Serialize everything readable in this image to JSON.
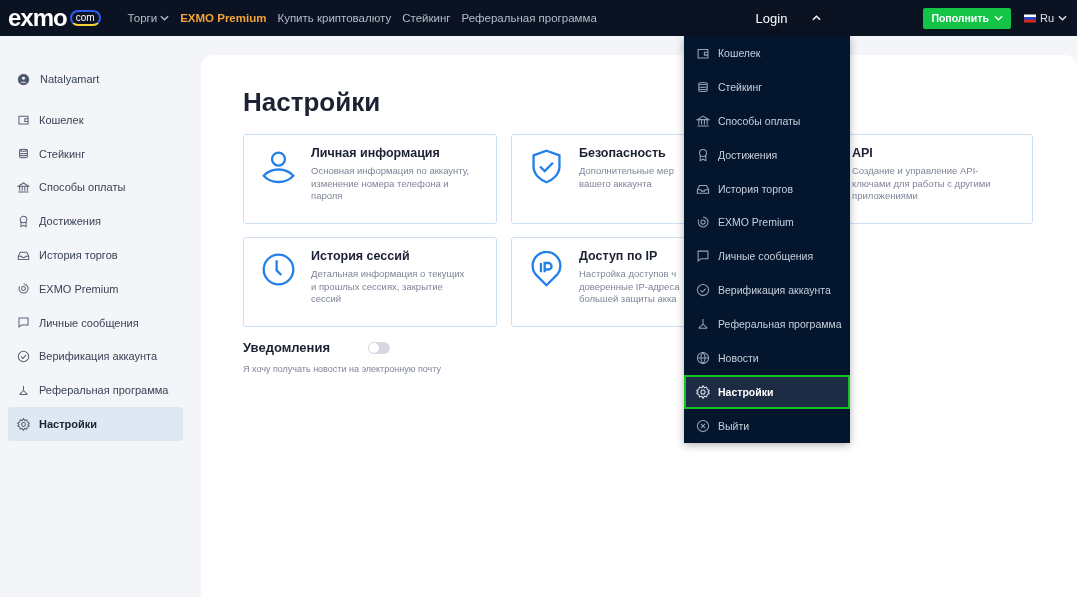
{
  "header": {
    "logo": "exmo",
    "logo_badge": "com",
    "nav": [
      {
        "label": "Торги",
        "dropdown": true,
        "highlight": false
      },
      {
        "label": "EXMO Premium",
        "dropdown": false,
        "highlight": true
      },
      {
        "label": "Купить криптовалюту",
        "dropdown": false,
        "highlight": false
      },
      {
        "label": "Стейкинг",
        "dropdown": false,
        "highlight": false
      },
      {
        "label": "Реферальная программа",
        "dropdown": false,
        "highlight": false
      }
    ],
    "account": {
      "label": "Login",
      "expanded": true
    },
    "deposit_button": "Пополнить",
    "language": "Ru"
  },
  "sidebar": {
    "user": "Natalyamart",
    "items": [
      {
        "label": "Кошелек",
        "selected": false
      },
      {
        "label": "Стейкинг",
        "selected": false
      },
      {
        "label": "Способы оплаты",
        "selected": false
      },
      {
        "label": "Достижения",
        "selected": false
      },
      {
        "label": "История торгов",
        "selected": false
      },
      {
        "label": "EXMO Premium",
        "selected": false
      },
      {
        "label": "Личные сообщения",
        "selected": false
      },
      {
        "label": "Верификация аккаунта",
        "selected": false
      },
      {
        "label": "Реферальная программа",
        "selected": false
      },
      {
        "label": "Настройки",
        "selected": true
      }
    ]
  },
  "page": {
    "title": "Настройки",
    "cards": [
      {
        "title": "Личная информация",
        "description_lines": [
          "Основная информация по аккаунту,",
          "изменение номера телефона и",
          "пароля"
        ]
      },
      {
        "title": "Безопасность",
        "description_lines": [
          "Дополнительные мер",
          "вашего аккаунта"
        ]
      },
      {
        "title": "API",
        "description_lines": [
          "Создание и управление API-",
          "ключами для работы с другими",
          "приложениями"
        ]
      },
      {
        "title": "История сессий",
        "description_lines": [
          "Детальная информация о текущих",
          "и прошлых сессиях, закрытие",
          "сессий"
        ]
      },
      {
        "title": "Доступ по IP",
        "description_lines": [
          "Настройка доступов ч",
          "доверенные IP-адреса",
          "большей защиты акка"
        ]
      }
    ],
    "notifications": {
      "label": "Уведомления",
      "on": false,
      "description": "Я хочу получать новости на электронную почту"
    }
  },
  "account_menu": {
    "items": [
      {
        "label": "Кошелек",
        "selected": false
      },
      {
        "label": "Стейкинг",
        "selected": false
      },
      {
        "label": "Способы оплаты",
        "selected": false
      },
      {
        "label": "Достижения",
        "selected": false
      },
      {
        "label": "История торгов",
        "selected": false
      },
      {
        "label": "EXMO Premium",
        "selected": false
      },
      {
        "label": "Личные сообщения",
        "selected": false
      },
      {
        "label": "Верификация аккаунта",
        "selected": false
      },
      {
        "label": "Реферальная программа",
        "selected": false
      },
      {
        "label": "Новости",
        "selected": false
      },
      {
        "label": "Настройки",
        "selected": true
      },
      {
        "label": "Выйти",
        "selected": false
      }
    ]
  }
}
